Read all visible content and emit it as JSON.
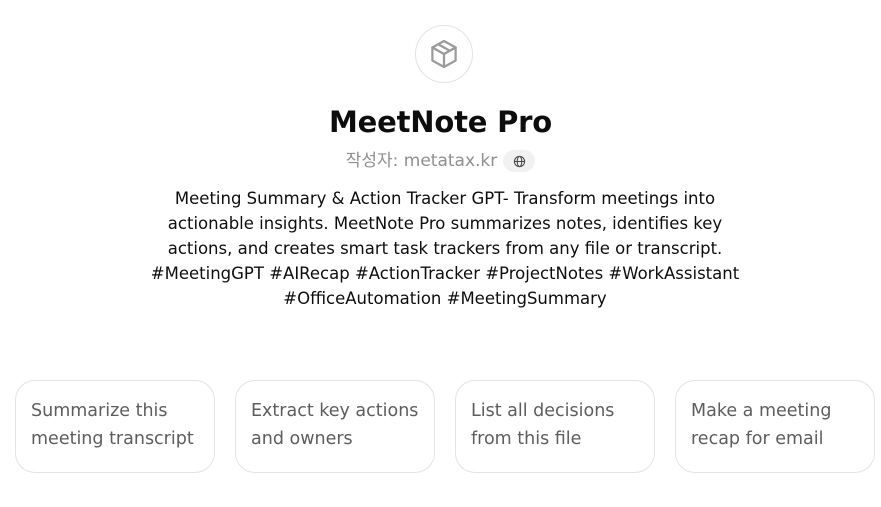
{
  "gpt": {
    "icon": "cube-icon",
    "name": "MeetNote Pro",
    "author_label": "작성자: metatax.kr",
    "author_link_icon": "globe-icon",
    "description": "Meeting Summary & Action Tracker GPT- Transform meetings into actionable insights. MeetNote Pro summarizes notes, identifies key actions, and creates smart task trackers from any file or transcript. #MeetingGPT #AIRecap #ActionTracker #ProjectNotes #WorkAssistant #OfficeAutomation #MeetingSummary"
  },
  "conversation_starters": [
    {
      "label": "Summarize this meeting transcript"
    },
    {
      "label": "Extract key actions and owners"
    },
    {
      "label": "List all decisions from this file"
    },
    {
      "label": "Make a meeting recap for email"
    }
  ]
}
